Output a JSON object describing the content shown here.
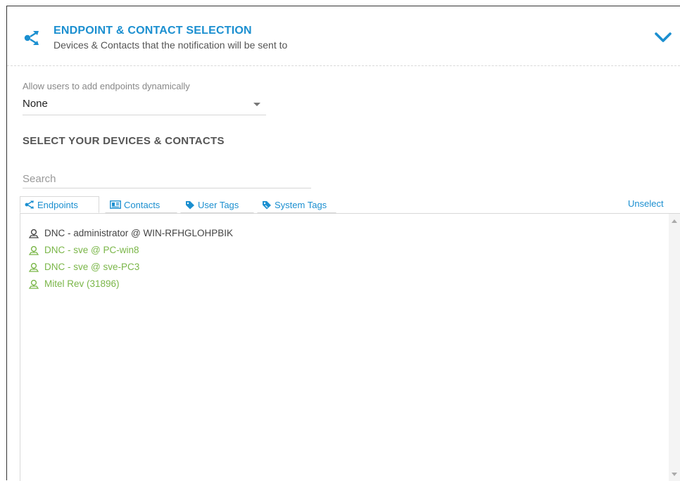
{
  "header": {
    "title": "ENDPOINT & CONTACT SELECTION",
    "subtitle": "Devices & Contacts that the notification will be sent to",
    "icon": "share-nodes-icon",
    "collapse_icon": "chevron-down-icon"
  },
  "dynamic": {
    "label": "Allow users to add endpoints dynamically",
    "value": "None"
  },
  "section_title": "SELECT YOUR DEVICES & CONTACTS",
  "search": {
    "placeholder": "Search",
    "value": ""
  },
  "tabs": [
    {
      "label": "Endpoints",
      "icon": "share-nodes-icon",
      "active": true
    },
    {
      "label": "Contacts",
      "icon": "contact-card-icon",
      "active": false
    },
    {
      "label": "User Tags",
      "icon": "tag-icon",
      "active": false
    },
    {
      "label": "System Tags",
      "icon": "tags-icon",
      "active": false
    }
  ],
  "unselect_label": "Unselect",
  "endpoints": [
    {
      "label": "DNC - administrator @ WIN-RFHGLOHPBIK",
      "color": "#444444"
    },
    {
      "label": "DNC - sve @ PC-win8",
      "color": "#7ab648"
    },
    {
      "label": "DNC - sve @ sve-PC3",
      "color": "#7ab648"
    },
    {
      "label": "Mitel Rev (31896)",
      "color": "#7ab648"
    }
  ],
  "colors": {
    "accent": "#1b8fd0",
    "online": "#7ab648",
    "offline": "#444444"
  }
}
